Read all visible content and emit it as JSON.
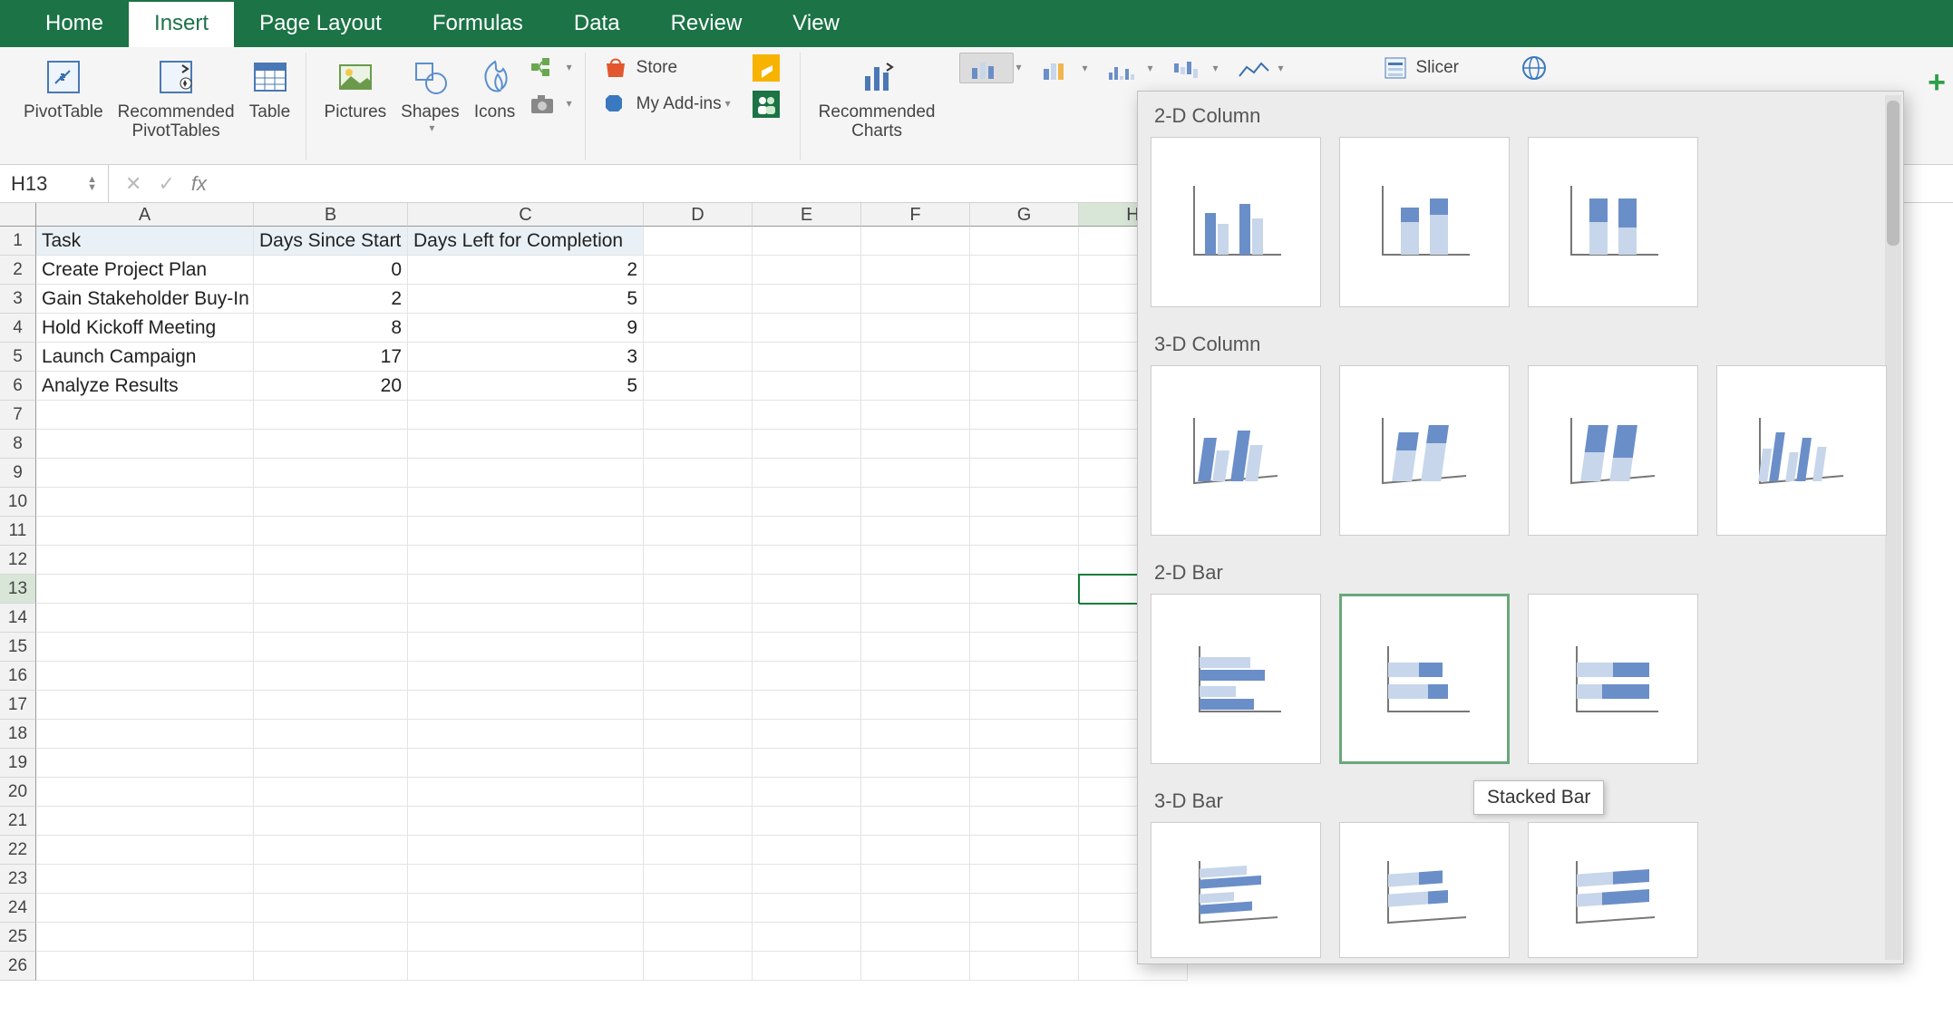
{
  "tabs": {
    "home": "Home",
    "insert": "Insert",
    "pagelayout": "Page Layout",
    "formulas": "Formulas",
    "data": "Data",
    "review": "Review",
    "view": "View"
  },
  "ribbon": {
    "pivottable": "PivotTable",
    "rec_pivot_l1": "Recommended",
    "rec_pivot_l2": "PivotTables",
    "table": "Table",
    "pictures": "Pictures",
    "shapes": "Shapes",
    "icons": "Icons",
    "store": "Store",
    "myaddins": "My Add-ins",
    "recch_l1": "Recommended",
    "recch_l2": "Charts",
    "slicer": "Slicer"
  },
  "namebox": "H13",
  "formula": "",
  "columns": [
    "A",
    "B",
    "C",
    "D",
    "E",
    "F",
    "G",
    "H"
  ],
  "rows": 26,
  "table": {
    "headers": {
      "a": "Task",
      "b": "Days Since Start",
      "c": "Days Left for Completion"
    },
    "data": [
      {
        "task": "Create Project Plan",
        "start": "0",
        "left": "2"
      },
      {
        "task": "Gain Stakeholder Buy-In",
        "start": "2",
        "left": "5"
      },
      {
        "task": "Hold Kickoff Meeting",
        "start": "8",
        "left": "9"
      },
      {
        "task": "Launch Campaign",
        "start": "17",
        "left": "3"
      },
      {
        "task": "Analyze Results",
        "start": "20",
        "left": "5"
      }
    ]
  },
  "chart_panel": {
    "s1": "2-D Column",
    "s2": "3-D Column",
    "s3": "2-D Bar",
    "s4": "3-D Bar",
    "tooltip": "Stacked Bar"
  }
}
